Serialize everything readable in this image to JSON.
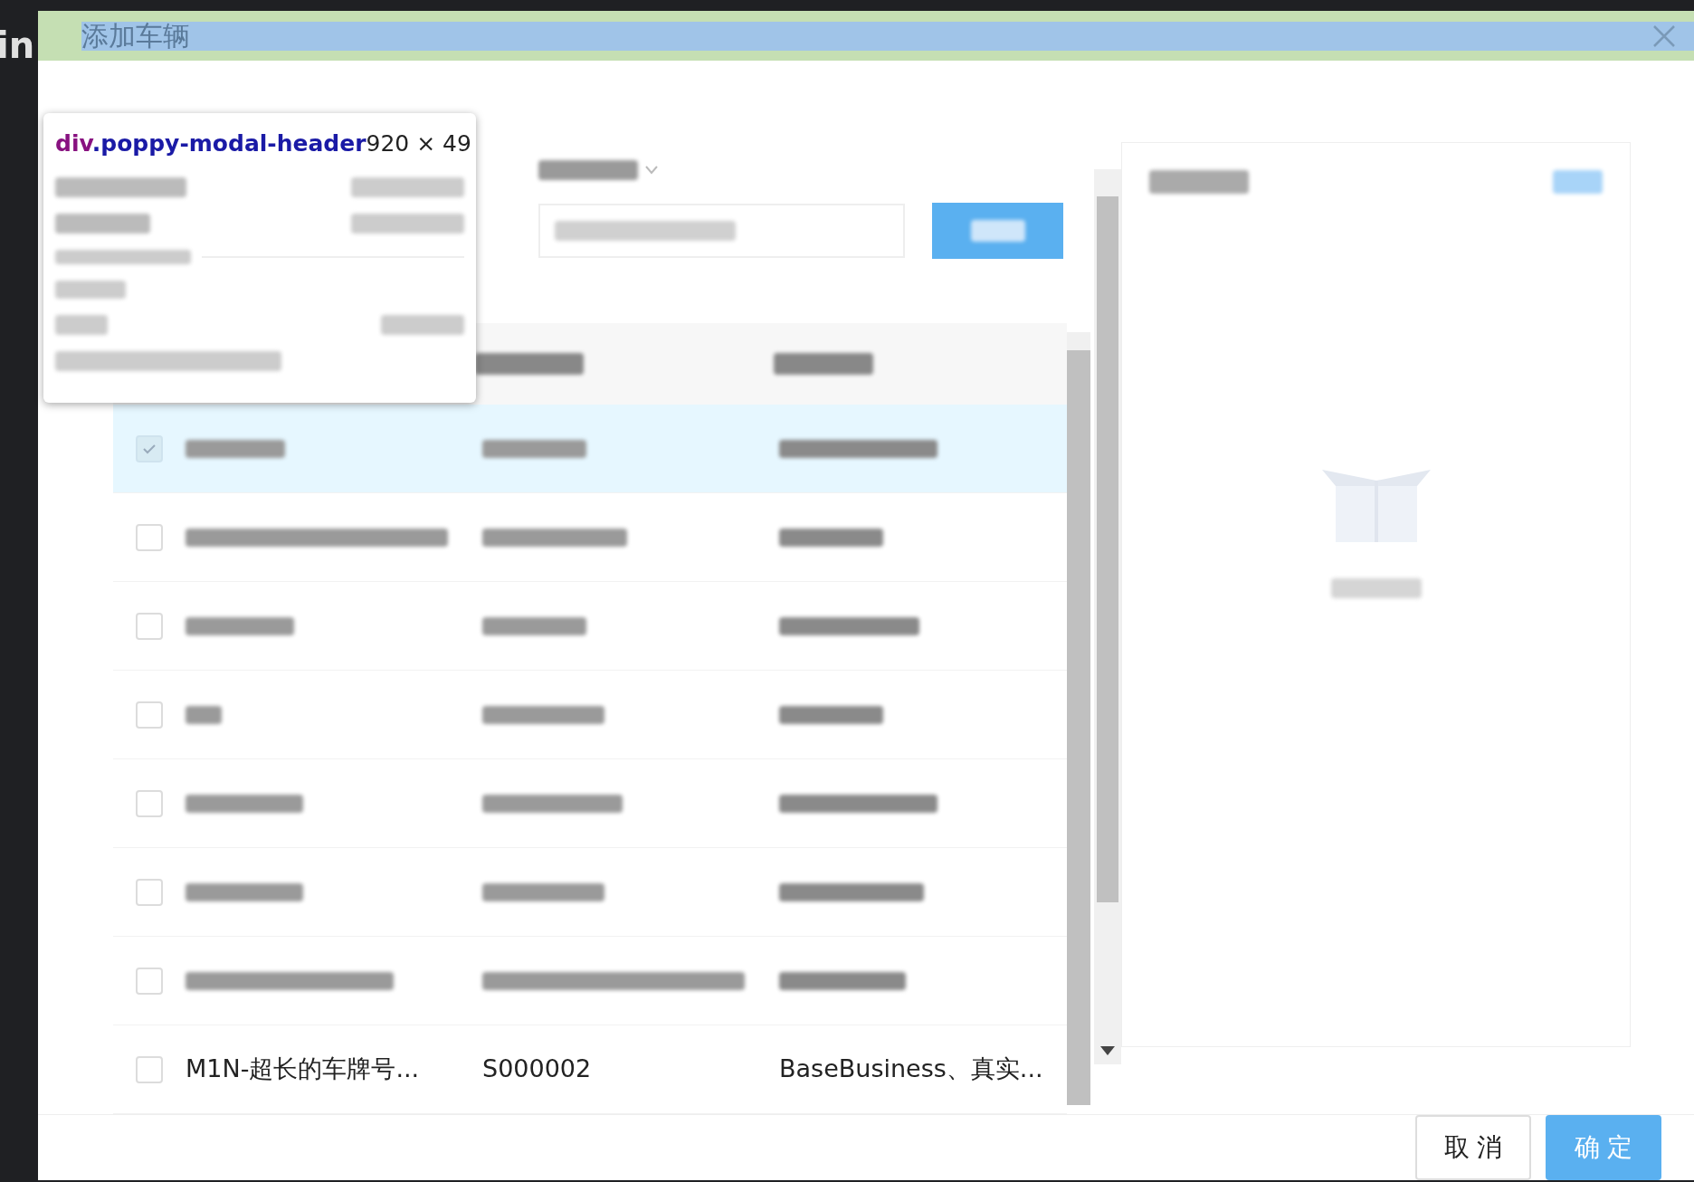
{
  "background_page": {
    "text": "in"
  },
  "modal": {
    "title": "添加车辆"
  },
  "inspector_tooltip": {
    "tag": "div",
    "class_name": ".poppy-modal-header",
    "size": "920 × 49"
  },
  "table": {
    "rows": [
      {
        "checked": true,
        "selected": true,
        "redacted": true
      },
      {
        "checked": false,
        "selected": false,
        "redacted": true
      },
      {
        "checked": false,
        "selected": false,
        "redacted": true
      },
      {
        "checked": false,
        "selected": false,
        "redacted": true
      },
      {
        "checked": false,
        "selected": false,
        "redacted": true
      },
      {
        "checked": false,
        "selected": false,
        "redacted": true
      },
      {
        "checked": false,
        "selected": false,
        "redacted": true
      },
      {
        "checked": false,
        "selected": false,
        "redacted": false,
        "cells": [
          "M1N-超长的车牌号...",
          "S000002",
          "BaseBusiness、真实..."
        ]
      }
    ]
  },
  "footer": {
    "buttons": [
      {
        "kind": "secondary",
        "label": "取 消"
      },
      {
        "kind": "primary",
        "label": "确 定"
      }
    ]
  }
}
